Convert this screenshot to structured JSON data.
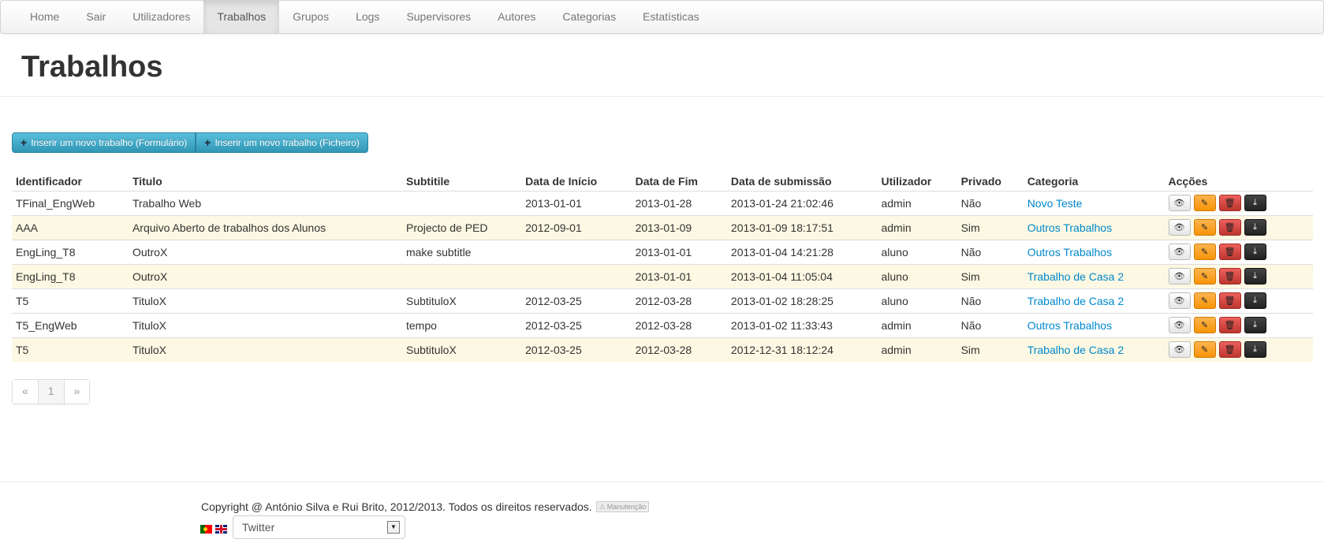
{
  "nav": {
    "items": [
      {
        "label": "Home"
      },
      {
        "label": "Sair"
      },
      {
        "label": "Utilizadores"
      },
      {
        "label": "Trabalhos"
      },
      {
        "label": "Grupos"
      },
      {
        "label": "Logs"
      },
      {
        "label": "Supervisores"
      },
      {
        "label": "Autores"
      },
      {
        "label": "Categorias"
      },
      {
        "label": "Estatísticas"
      }
    ],
    "active": "Trabalhos"
  },
  "page": {
    "title": "Trabalhos"
  },
  "toolbar": {
    "insert_form_label": "Inserir um novo trabalho (Formulário)",
    "insert_file_label": "Inserir um novo trabalho (Ficheiro)",
    "plus_icon": "+"
  },
  "table": {
    "headers": [
      "Identificador",
      "Titulo",
      "Subtitile",
      "Data de Início",
      "Data de Fim",
      "Data de submissão",
      "Utilizador",
      "Privado",
      "Categoria",
      "Acções"
    ],
    "rows": [
      {
        "id": "TFinal_EngWeb",
        "title": "Trabalho Web",
        "subtitle": "",
        "start": "2013-01-01",
        "end": "2013-01-28",
        "submitted": "2013-01-24 21:02:46",
        "user": "admin",
        "private": "Não",
        "category": "Novo Teste"
      },
      {
        "id": "AAA",
        "title": "Arquivo Aberto de trabalhos dos Alunos",
        "subtitle": "Projecto de PED",
        "start": "2012-09-01",
        "end": "2013-01-09",
        "submitted": "2013-01-09 18:17:51",
        "user": "admin",
        "private": "Sim",
        "category": "Outros Trabalhos"
      },
      {
        "id": "EngLing_T8",
        "title": "OutroX",
        "subtitle": "make subtitle",
        "start": "",
        "end": "2013-01-01",
        "submitted": "2013-01-04 14:21:28",
        "user": "aluno",
        "private": "Não",
        "category": "Outros Trabalhos"
      },
      {
        "id": "EngLing_T8",
        "title": "OutroX",
        "subtitle": "",
        "start": "",
        "end": "2013-01-01",
        "submitted": "2013-01-04 11:05:04",
        "user": "aluno",
        "private": "Sim",
        "category": "Trabalho de Casa 2"
      },
      {
        "id": "T5",
        "title": "TituloX",
        "subtitle": "SubtituloX",
        "start": "2012-03-25",
        "end": "2012-03-28",
        "submitted": "2013-01-02 18:28:25",
        "user": "aluno",
        "private": "Não",
        "category": "Trabalho de Casa 2"
      },
      {
        "id": "T5_EngWeb",
        "title": "TituloX",
        "subtitle": "tempo",
        "start": "2012-03-25",
        "end": "2012-03-28",
        "submitted": "2013-01-02 11:33:43",
        "user": "admin",
        "private": "Não",
        "category": "Outros Trabalhos"
      },
      {
        "id": "T5",
        "title": "TituloX",
        "subtitle": "SubtituloX",
        "start": "2012-03-25",
        "end": "2012-03-28",
        "submitted": "2012-12-31 18:12:24",
        "user": "admin",
        "private": "Sim",
        "category": "Trabalho de Casa 2"
      }
    ],
    "action_icons": {
      "view": "eye-icon",
      "edit": "pencil-icon",
      "delete": "trash-icon",
      "download": "download-icon"
    },
    "action_colors": {
      "view": "#e6e6e6",
      "edit": "#f89406",
      "delete": "#bd362f",
      "download": "#222222"
    }
  },
  "pagination": {
    "prev": "«",
    "current": "1",
    "next": "»"
  },
  "footer": {
    "copyright": "Copyright @ António Silva e Rui Brito, 2012/2013. Todos os direitos reservados.",
    "badge": "Manutenção",
    "select_value": "Twitter"
  },
  "colors": {
    "link": "#0088cc",
    "info": "#2f96b4",
    "warning_row": "#fcf8e3"
  }
}
